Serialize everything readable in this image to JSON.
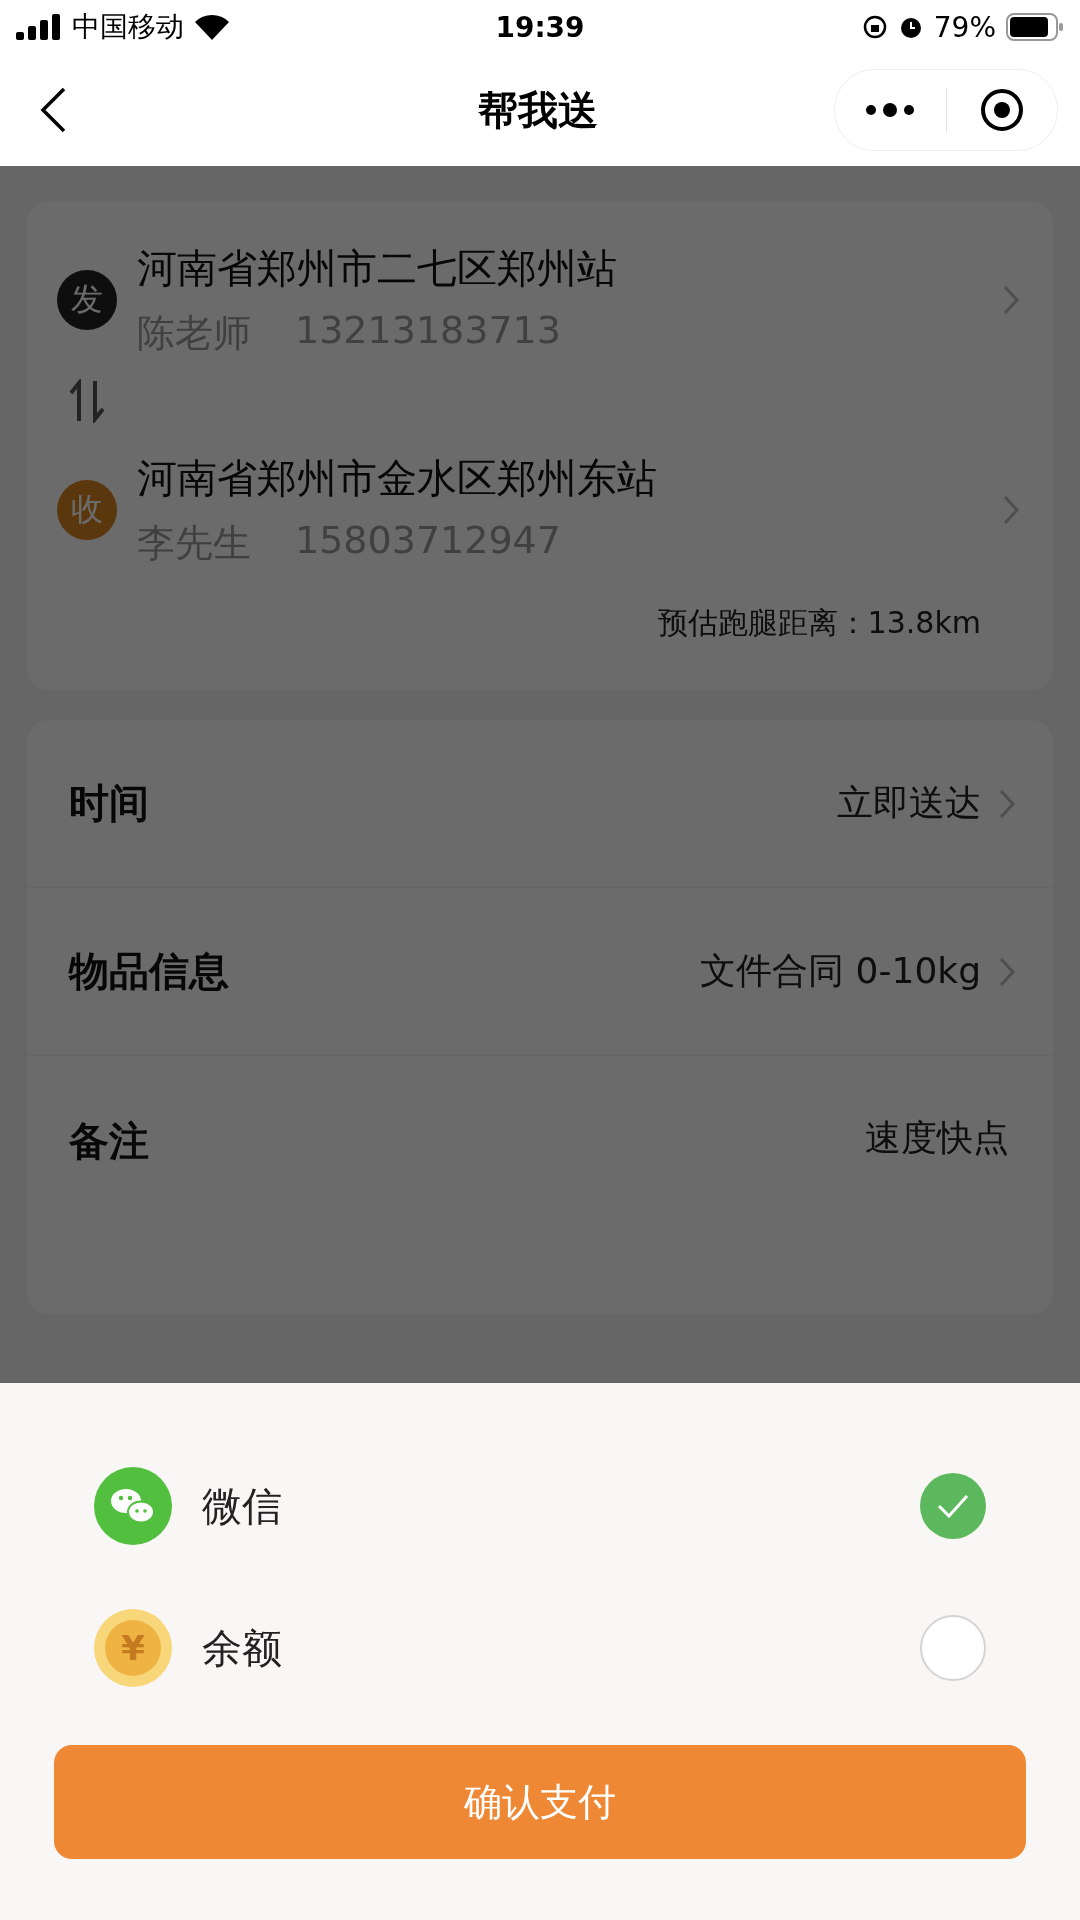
{
  "status_bar": {
    "carrier": "中国移动",
    "time": "19:39",
    "battery": "79%"
  },
  "nav": {
    "title": "帮我送"
  },
  "route": {
    "stops": [
      {
        "badge": "发",
        "kind": "sender",
        "address": "河南省郑州市二七区郑州站",
        "name": "陈老师",
        "phone": "13213183713"
      },
      {
        "badge": "收",
        "kind": "receiver",
        "address": "河南省郑州市金水区郑州东站",
        "name": "李先生",
        "phone": "15803712947"
      }
    ],
    "distance": "预估跑腿距离：13.8km"
  },
  "details": [
    {
      "label": "时间",
      "value": "立即送达",
      "arrow": true
    },
    {
      "label": "物品信息",
      "value": "文件合同 0-10kg",
      "arrow": true
    },
    {
      "label": "备注",
      "value": "速度快点",
      "arrow": false
    }
  ],
  "payment": {
    "methods": [
      {
        "kind": "wechat",
        "label": "微信",
        "selected": true
      },
      {
        "kind": "balance",
        "label": "余额",
        "icon_text": "¥",
        "selected": false
      }
    ],
    "confirm": "确认支付"
  }
}
